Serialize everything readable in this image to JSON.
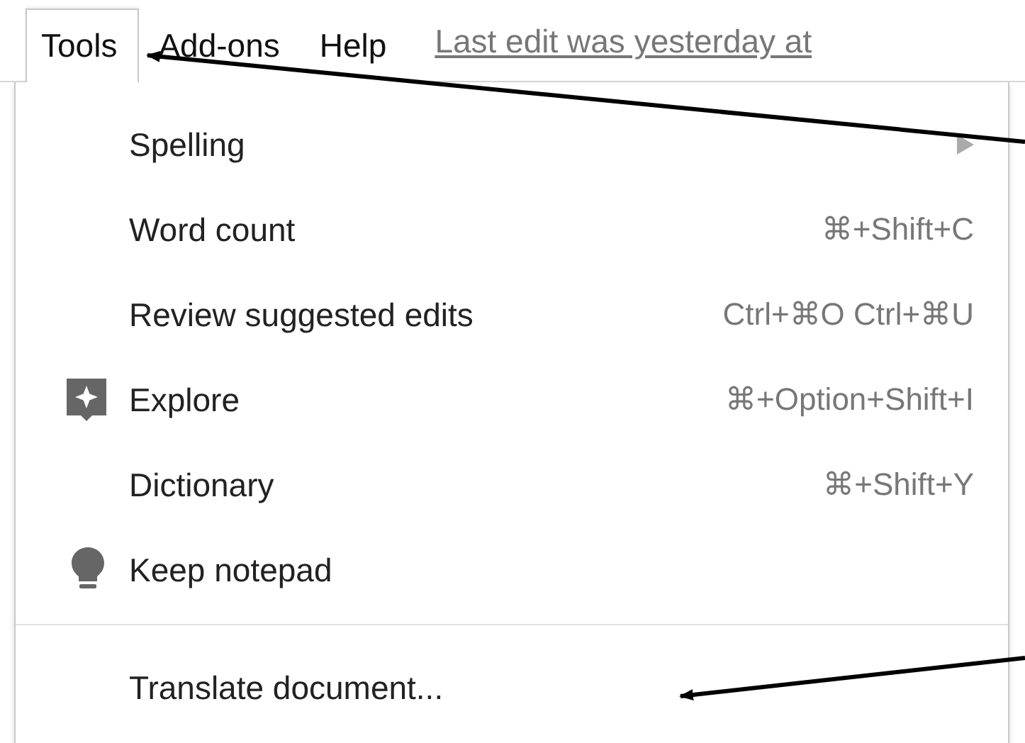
{
  "menubar": {
    "menus": [
      {
        "label": "Tools",
        "selected": true
      },
      {
        "label": "Add-ons",
        "selected": false
      },
      {
        "label": "Help",
        "selected": false
      }
    ],
    "last_edit": "Last edit was yesterday at"
  },
  "menu": {
    "sections": [
      {
        "items": [
          {
            "label": "Spelling",
            "kind": "submenu"
          },
          {
            "label": "Word count",
            "kind": "plain",
            "shortcut": "⌘+Shift+C"
          },
          {
            "label": "Review suggested edits",
            "kind": "plain",
            "shortcut": "Ctrl+⌘O Ctrl+⌘U"
          },
          {
            "label": "Explore",
            "kind": "explore",
            "shortcut": "⌘+Option+Shift+I"
          },
          {
            "label": "Dictionary",
            "kind": "plain",
            "shortcut": "⌘+Shift+Y"
          },
          {
            "label": "Keep notepad",
            "kind": "keep"
          }
        ]
      },
      {
        "items": [
          {
            "label": "Translate document...",
            "kind": "plain"
          }
        ]
      }
    ]
  }
}
